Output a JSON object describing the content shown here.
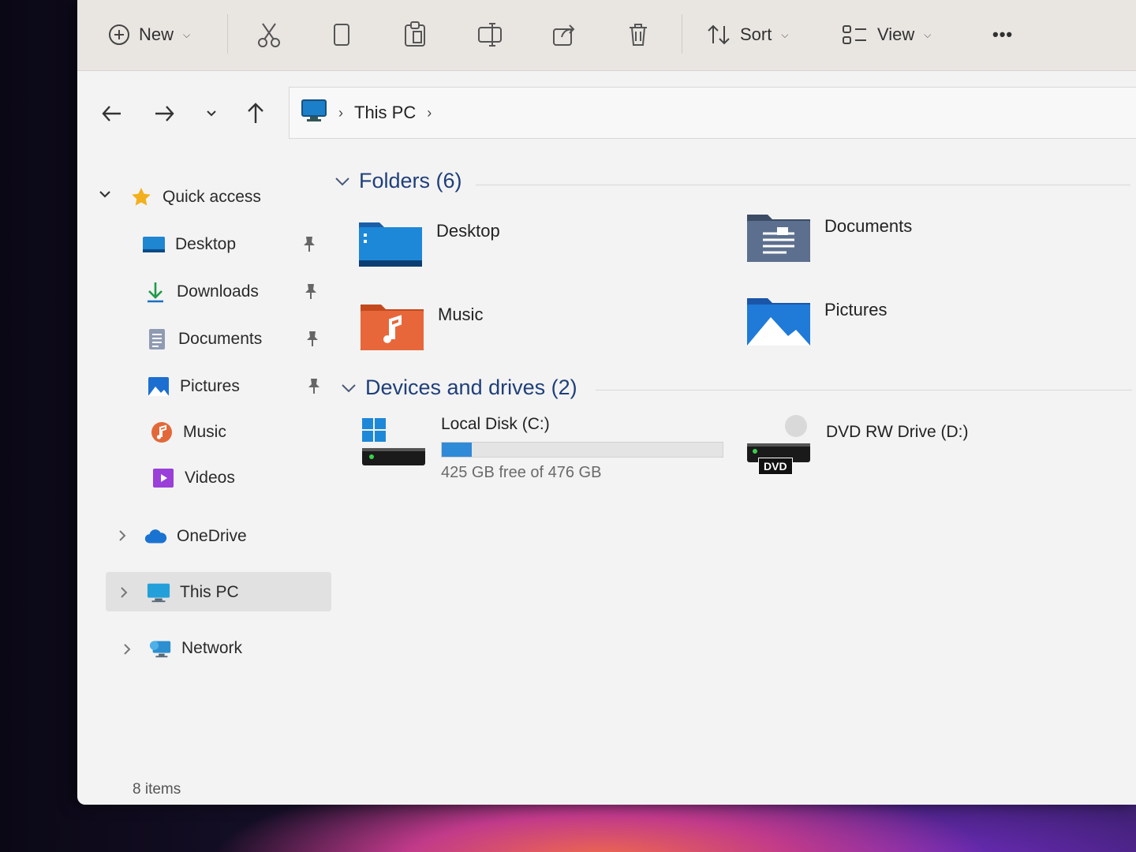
{
  "toolbar": {
    "new_label": "New",
    "sort_label": "Sort",
    "view_label": "View",
    "more_label": "•••"
  },
  "address": {
    "segments": [
      "This PC"
    ]
  },
  "sidebar": {
    "quick_access": "Quick access",
    "items": [
      {
        "label": "Desktop",
        "pinned": true
      },
      {
        "label": "Downloads",
        "pinned": true
      },
      {
        "label": "Documents",
        "pinned": true
      },
      {
        "label": "Pictures",
        "pinned": true
      },
      {
        "label": "Music",
        "pinned": false
      },
      {
        "label": "Videos",
        "pinned": false
      }
    ],
    "onedrive": "OneDrive",
    "this_pc": "This PC",
    "network": "Network"
  },
  "content": {
    "folders_header": "Folders (6)",
    "folders": [
      {
        "label": "Desktop"
      },
      {
        "label": "Documents"
      },
      {
        "label": "Music"
      },
      {
        "label": "Pictures"
      }
    ],
    "drives_header": "Devices and drives (2)",
    "drives": [
      {
        "label": "Local Disk (C:)",
        "free": "425 GB free of 476 GB",
        "used_fraction": 0.107
      },
      {
        "label": "DVD RW Drive (D:)",
        "badge": "DVD"
      }
    ]
  },
  "status": {
    "items_count": "8 items"
  },
  "colors": {
    "accent": "#2f8ad8",
    "section_text": "#1f3f7a"
  }
}
